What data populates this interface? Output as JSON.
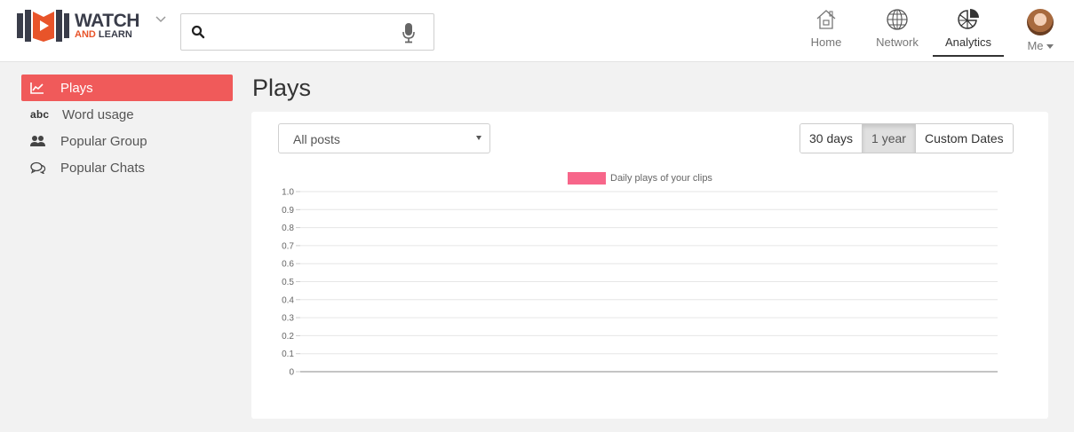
{
  "app": {
    "logo_line1": "WATCH",
    "logo_and": "AND",
    "logo_line2": "LEARN"
  },
  "search": {
    "value": "",
    "placeholder": ""
  },
  "nav": {
    "home": "Home",
    "network": "Network",
    "analytics": "Analytics",
    "me": "Me"
  },
  "sidebar": {
    "items": [
      {
        "label": "Plays",
        "icon": "line-chart-icon",
        "active": true
      },
      {
        "label": "Word usage",
        "icon": "abc-icon",
        "icon_text": "abc",
        "active": false
      },
      {
        "label": "Popular Group",
        "icon": "users-icon",
        "active": false
      },
      {
        "label": "Popular Chats",
        "icon": "chat-bubbles-icon",
        "active": false
      }
    ]
  },
  "main": {
    "title": "Plays",
    "filter": {
      "selected": "All posts"
    },
    "ranges": [
      {
        "label": "30 days",
        "active": false
      },
      {
        "label": "1 year",
        "active": true
      },
      {
        "label": "Custom Dates",
        "active": false
      }
    ]
  },
  "colors": {
    "accent": "#f05a5a",
    "series": "#f7668a"
  },
  "chart_data": {
    "type": "bar",
    "title": "",
    "xlabel": "",
    "ylabel": "",
    "ylim": [
      0,
      1.0
    ],
    "y_ticks": [
      "0",
      "0.1",
      "0.2",
      "0.3",
      "0.4",
      "0.5",
      "0.6",
      "0.7",
      "0.8",
      "0.9",
      "1.0"
    ],
    "legend_position": "top",
    "grid": true,
    "categories": [],
    "series": [
      {
        "name": "Daily plays of your clips",
        "values": []
      }
    ]
  }
}
